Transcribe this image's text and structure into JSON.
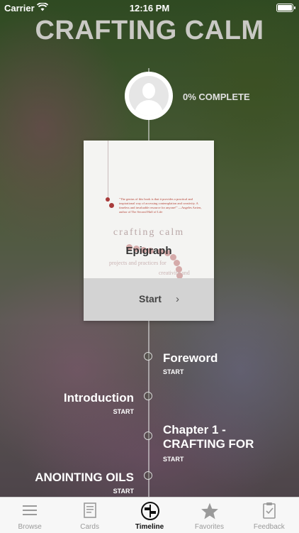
{
  "status_bar": {
    "carrier": "Carrier",
    "time": "12:16 PM"
  },
  "header": {
    "title": "CRAFTING CALM"
  },
  "profile": {
    "progress_label": "0% COMPLETE",
    "progress_percent": 0
  },
  "featured_card": {
    "chapter": "Epigraph",
    "cover_title": "crafting calm",
    "cover_subtitle": "projects and practices for",
    "cover_subtitle2": "creativity and",
    "start_label": "Start",
    "chevron": "›",
    "blurb": "\"The genius of this book is that it provides a practical and inspirational way of accessing contemplation and creativity. A timeless and invaluable resource for anyone!\" —Angeles Arrien, author of The Second Half of Life"
  },
  "timeline": {
    "entries": [
      {
        "title": "Foreword",
        "start": "START",
        "side": "right"
      },
      {
        "title": "Introduction",
        "start": "START",
        "side": "left"
      },
      {
        "title": "Chapter 1 -\nCRAFTING FOR",
        "start": "START",
        "side": "right"
      },
      {
        "title": "ANOINTING OILS",
        "start": "START",
        "side": "left"
      }
    ]
  },
  "tabbar": {
    "tabs": [
      {
        "label": "Browse",
        "icon": "browse-icon",
        "active": false
      },
      {
        "label": "Cards",
        "icon": "cards-icon",
        "active": false
      },
      {
        "label": "Timeline",
        "icon": "timeline-icon",
        "active": true
      },
      {
        "label": "Favorites",
        "icon": "star-icon",
        "active": false
      },
      {
        "label": "Feedback",
        "icon": "clipboard-icon",
        "active": false
      }
    ]
  },
  "colors": {
    "accent": "#111111",
    "inactive": "#9a9a9a",
    "title": "#c9c9c4"
  }
}
